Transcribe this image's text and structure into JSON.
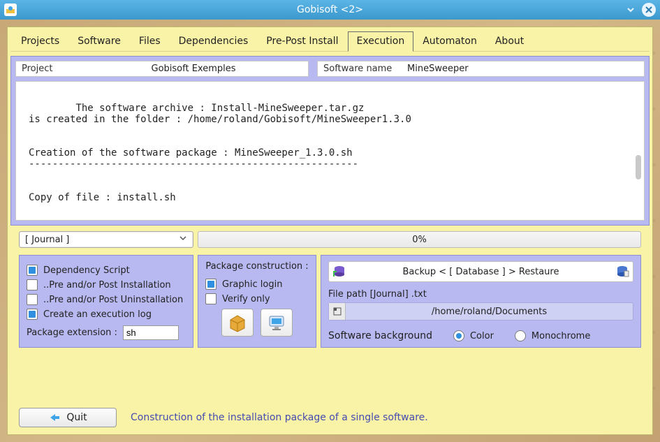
{
  "window": {
    "title": "Gobisoft <2>"
  },
  "tabs": {
    "items": [
      "Projects",
      "Software",
      "Files",
      "Dependencies",
      "Pre-Post Install",
      "Execution",
      "Automaton",
      "About"
    ],
    "active_index": 5
  },
  "project_field": {
    "label": "Project",
    "value": "Gobisoft Exemples"
  },
  "software_field": {
    "label": "Software name",
    "value": "MineSweeper"
  },
  "log_text": "The software archive : Install-MineSweeper.tar.gz\nis created in the folder : /home/roland/Gobisoft/MineSweeper1.3.0\n\n\nCreation of the software package : MineSweeper_1.3.0.sh\n--------------------------------------------------------\n\n\nCopy of file : install.sh",
  "journal_combo": {
    "label": "[ Journal ]"
  },
  "progress": {
    "text": "0%"
  },
  "left_card": {
    "dependency_script": {
      "label": "Dependency Script",
      "checked": true
    },
    "pre_post_install": {
      "label": "..Pre and/or Post Installation",
      "checked": false
    },
    "pre_post_uninstall": {
      "label": "..Pre and/or Post Uninstallation",
      "checked": false
    },
    "create_log": {
      "label": "Create an execution log",
      "checked": true
    },
    "extension_label": "Package extension :",
    "extension_value": "sh"
  },
  "mid_card": {
    "section_label": "Package construction :",
    "graphic_login": {
      "label": "Graphic login",
      "checked": true
    },
    "verify_only": {
      "label": "Verify only",
      "checked": false
    }
  },
  "right_card": {
    "backup_label": "Backup  < [ Database ] >  Restaure",
    "filepath_label": "File path [Journal] .txt",
    "filepath_value": "/home/roland/Documents",
    "bg_label": "Software background",
    "radio_color": "Color",
    "radio_mono": "Monochrome",
    "bg_selected": "color"
  },
  "bottom": {
    "quit_label": "Quit",
    "status": "Construction of the installation package of a single software."
  }
}
